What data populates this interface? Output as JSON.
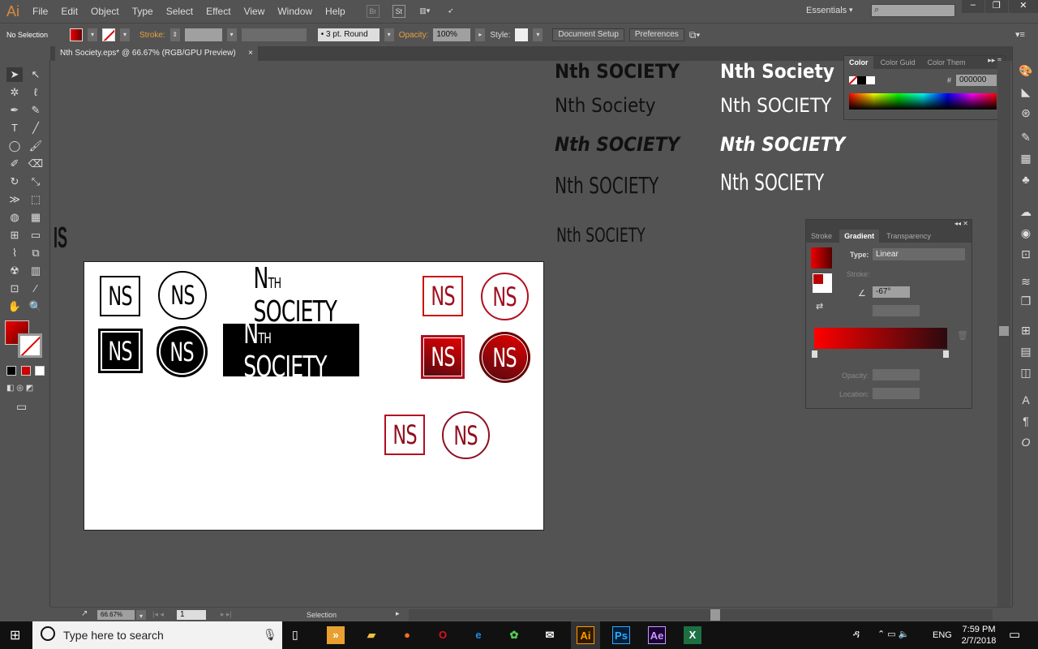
{
  "app": {
    "logo": "Ai",
    "menu": [
      "File",
      "Edit",
      "Object",
      "Type",
      "Select",
      "Effect",
      "View",
      "Window",
      "Help"
    ],
    "bridge": "Br",
    "stock": "St",
    "workspace": "Essentials",
    "search_placeholder": ""
  },
  "control_bar": {
    "selection": "No Selection",
    "stroke_label": "Stroke:",
    "brush": "3 pt. Round",
    "opacity_label": "Opacity:",
    "opacity": "100%",
    "style_label": "Style:",
    "document_setup": "Document Setup",
    "preferences": "Preferences"
  },
  "document_tab": {
    "title": "Nth Society.eps* @ 66.67% (RGB/GPU Preview)",
    "close": "×"
  },
  "color_panel": {
    "tabs": [
      "Color",
      "Color Guid",
      "Color Them"
    ],
    "hex_label": "#",
    "hex": "000000"
  },
  "gradient_panel": {
    "tabs": [
      "Stroke",
      "Gradient",
      "Transparency"
    ],
    "type_label": "Type:",
    "type": "Linear",
    "stroke_label": "Stroke:",
    "angle": "-67°",
    "opacity_label": "Opacity:",
    "location_label": "Location:",
    "start_color": "#ff0000",
    "end_color": "#2a0a0e"
  },
  "canvas": {
    "wordmarks": [
      "Nth SOCIETY",
      "Nth Society",
      "Nth SOCIETY",
      "Nth SOCIETY",
      "Nth SOCIETY",
      "Nth Society",
      "Nth SOCIETY",
      "Nth SOCIETY",
      "Nth SOCIETY"
    ],
    "clipped": "IS",
    "logos": {
      "monogram": "NS",
      "wordmark_n": "N",
      "wordmark_th": "TH",
      "wordmark_society": "SOCIETY"
    }
  },
  "status": {
    "zoom": "66.67%",
    "page": "1",
    "tool": "Selection"
  },
  "taskbar": {
    "search": "Type here to search",
    "time": "7:59 PM",
    "date": "2/7/2018",
    "lang": "ENG",
    "apps": [
      "Ai",
      "Ps",
      "Ae",
      "X"
    ]
  },
  "colors": {
    "accent": "#cc1a1a",
    "ui_bg": "#535353"
  }
}
